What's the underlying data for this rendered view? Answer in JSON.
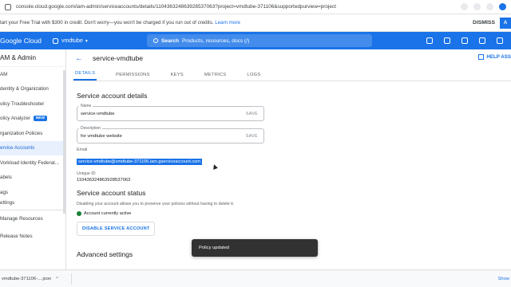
{
  "browser": {
    "url": "console.cloud.google.com/iam-admin/serviceaccounts/details/110436324863928537063?project=vmdtube-371106&supportedpurview=project"
  },
  "trial_banner": {
    "text": "tart your Free Trial with $300 in credit. Don't worry—you won't be charged if you run out of credits.",
    "link": "Learn more",
    "dismiss": "DISMISS",
    "activate": "A"
  },
  "header": {
    "brand": "Google Cloud",
    "project": "vmdtube",
    "search_label": "Search",
    "search_placeholder": "Products, resources, docs (/)"
  },
  "sidebar": {
    "title": "AM & Admin",
    "items": [
      {
        "label": "AM"
      },
      {
        "label": "dentity & Organization"
      },
      {
        "label": "olicy Troubleshooter"
      },
      {
        "label": "olicy Analyzer",
        "badge": "NEW"
      },
      {
        "label": "rganization Policies"
      },
      {
        "label": "ervice Accounts",
        "active": true
      },
      {
        "label": "Vorkload Identity Federat..."
      },
      {
        "label": "abels"
      },
      {
        "label": "ags"
      },
      {
        "label": "ettings"
      }
    ],
    "bottom_items": [
      {
        "label": "Manage Resources"
      },
      {
        "label": "Release Notes"
      }
    ]
  },
  "page": {
    "title": "service-vmdtube",
    "help": "HELP ASS",
    "tabs": [
      "DETAILS",
      "PERMISSIONS",
      "KEYS",
      "METRICS",
      "LOGS"
    ],
    "details_heading": "Service account details",
    "name_label": "Name",
    "name_value": "service-vmdtube",
    "save": "SAVE",
    "description_label": "Description",
    "description_value": "for vmdtube website",
    "email_label": "Email",
    "email_value": "service-vmdtube@vmdtube-371106.iam.gserviceaccount.com",
    "uid_label": "Unique ID",
    "uid_value": "110436324863928537063",
    "status_heading": "Service account status",
    "status_desc": "Disabling your account allows you to preserve your policies without having to delete it.",
    "status_active": "Account currently active",
    "disable_button": "DISABLE SERVICE ACCOUNT",
    "advanced_heading": "Advanced settings"
  },
  "toast": {
    "message": "Policy updated"
  },
  "downloads": {
    "file": "vmdtube-371106-....json",
    "show_all": "Show"
  }
}
